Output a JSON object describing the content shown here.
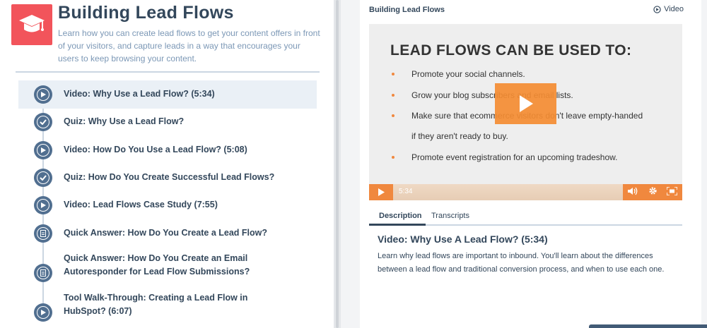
{
  "course": {
    "title": "Building Lead Flows",
    "description": "Learn how you can create lead flows to get your content offers in front of your visitors, and capture leads in a way that encourages your users to keep browsing your content.",
    "icon": "graduation-cap-icon"
  },
  "lessons": [
    {
      "label": "Video: Why Use a Lead Flow? (5:34)",
      "icon": "play-circle-icon",
      "active": true
    },
    {
      "label": "Quiz: Why Use a Lead Flow?",
      "icon": "check-circle-icon",
      "active": false
    },
    {
      "label": "Video: How Do You Use a Lead Flow? (5:08)",
      "icon": "play-circle-icon",
      "active": false
    },
    {
      "label": "Quiz: How Do You Create Successful Lead Flows?",
      "icon": "check-circle-icon",
      "active": false
    },
    {
      "label": "Video: Lead Flows Case Study (7:55)",
      "icon": "play-circle-icon",
      "active": false
    },
    {
      "label": "Quick Answer: How Do You Create a Lead Flow?",
      "icon": "document-icon",
      "active": false
    },
    {
      "label": "Quick Answer: How Do You Create an Email Autoresponder for Lead Flow Submissions?",
      "icon": "document-icon",
      "active": false
    },
    {
      "label": "Tool Walk-Through: Creating a Lead Flow in HubSpot? (6:07)",
      "icon": "play-circle-icon",
      "active": false
    }
  ],
  "player": {
    "header_title": "Building Lead Flows",
    "type_label": "Video",
    "slide_title": "LEAD FLOWS CAN BE USED TO:",
    "slide_bullets": [
      "Promote your social channels.",
      "Grow your blog subscribers and email lists.",
      "Make sure that ecommerce visitors don't leave empty-handed",
      "if they aren't ready to buy.",
      "Promote event registration for an upcoming tradeshow."
    ],
    "time": "5:34",
    "accent": "#f0883e"
  },
  "tabs": [
    {
      "label": "Description",
      "active": true
    },
    {
      "label": "Transcripts",
      "active": false
    }
  ],
  "details": {
    "title": "Video: Why Use A Lead Flow? (5:34)",
    "text": "Learn why lead flows are important to inbound. You'll learn about the differences between a lead flow and traditional conversion process, and when to use each one."
  }
}
